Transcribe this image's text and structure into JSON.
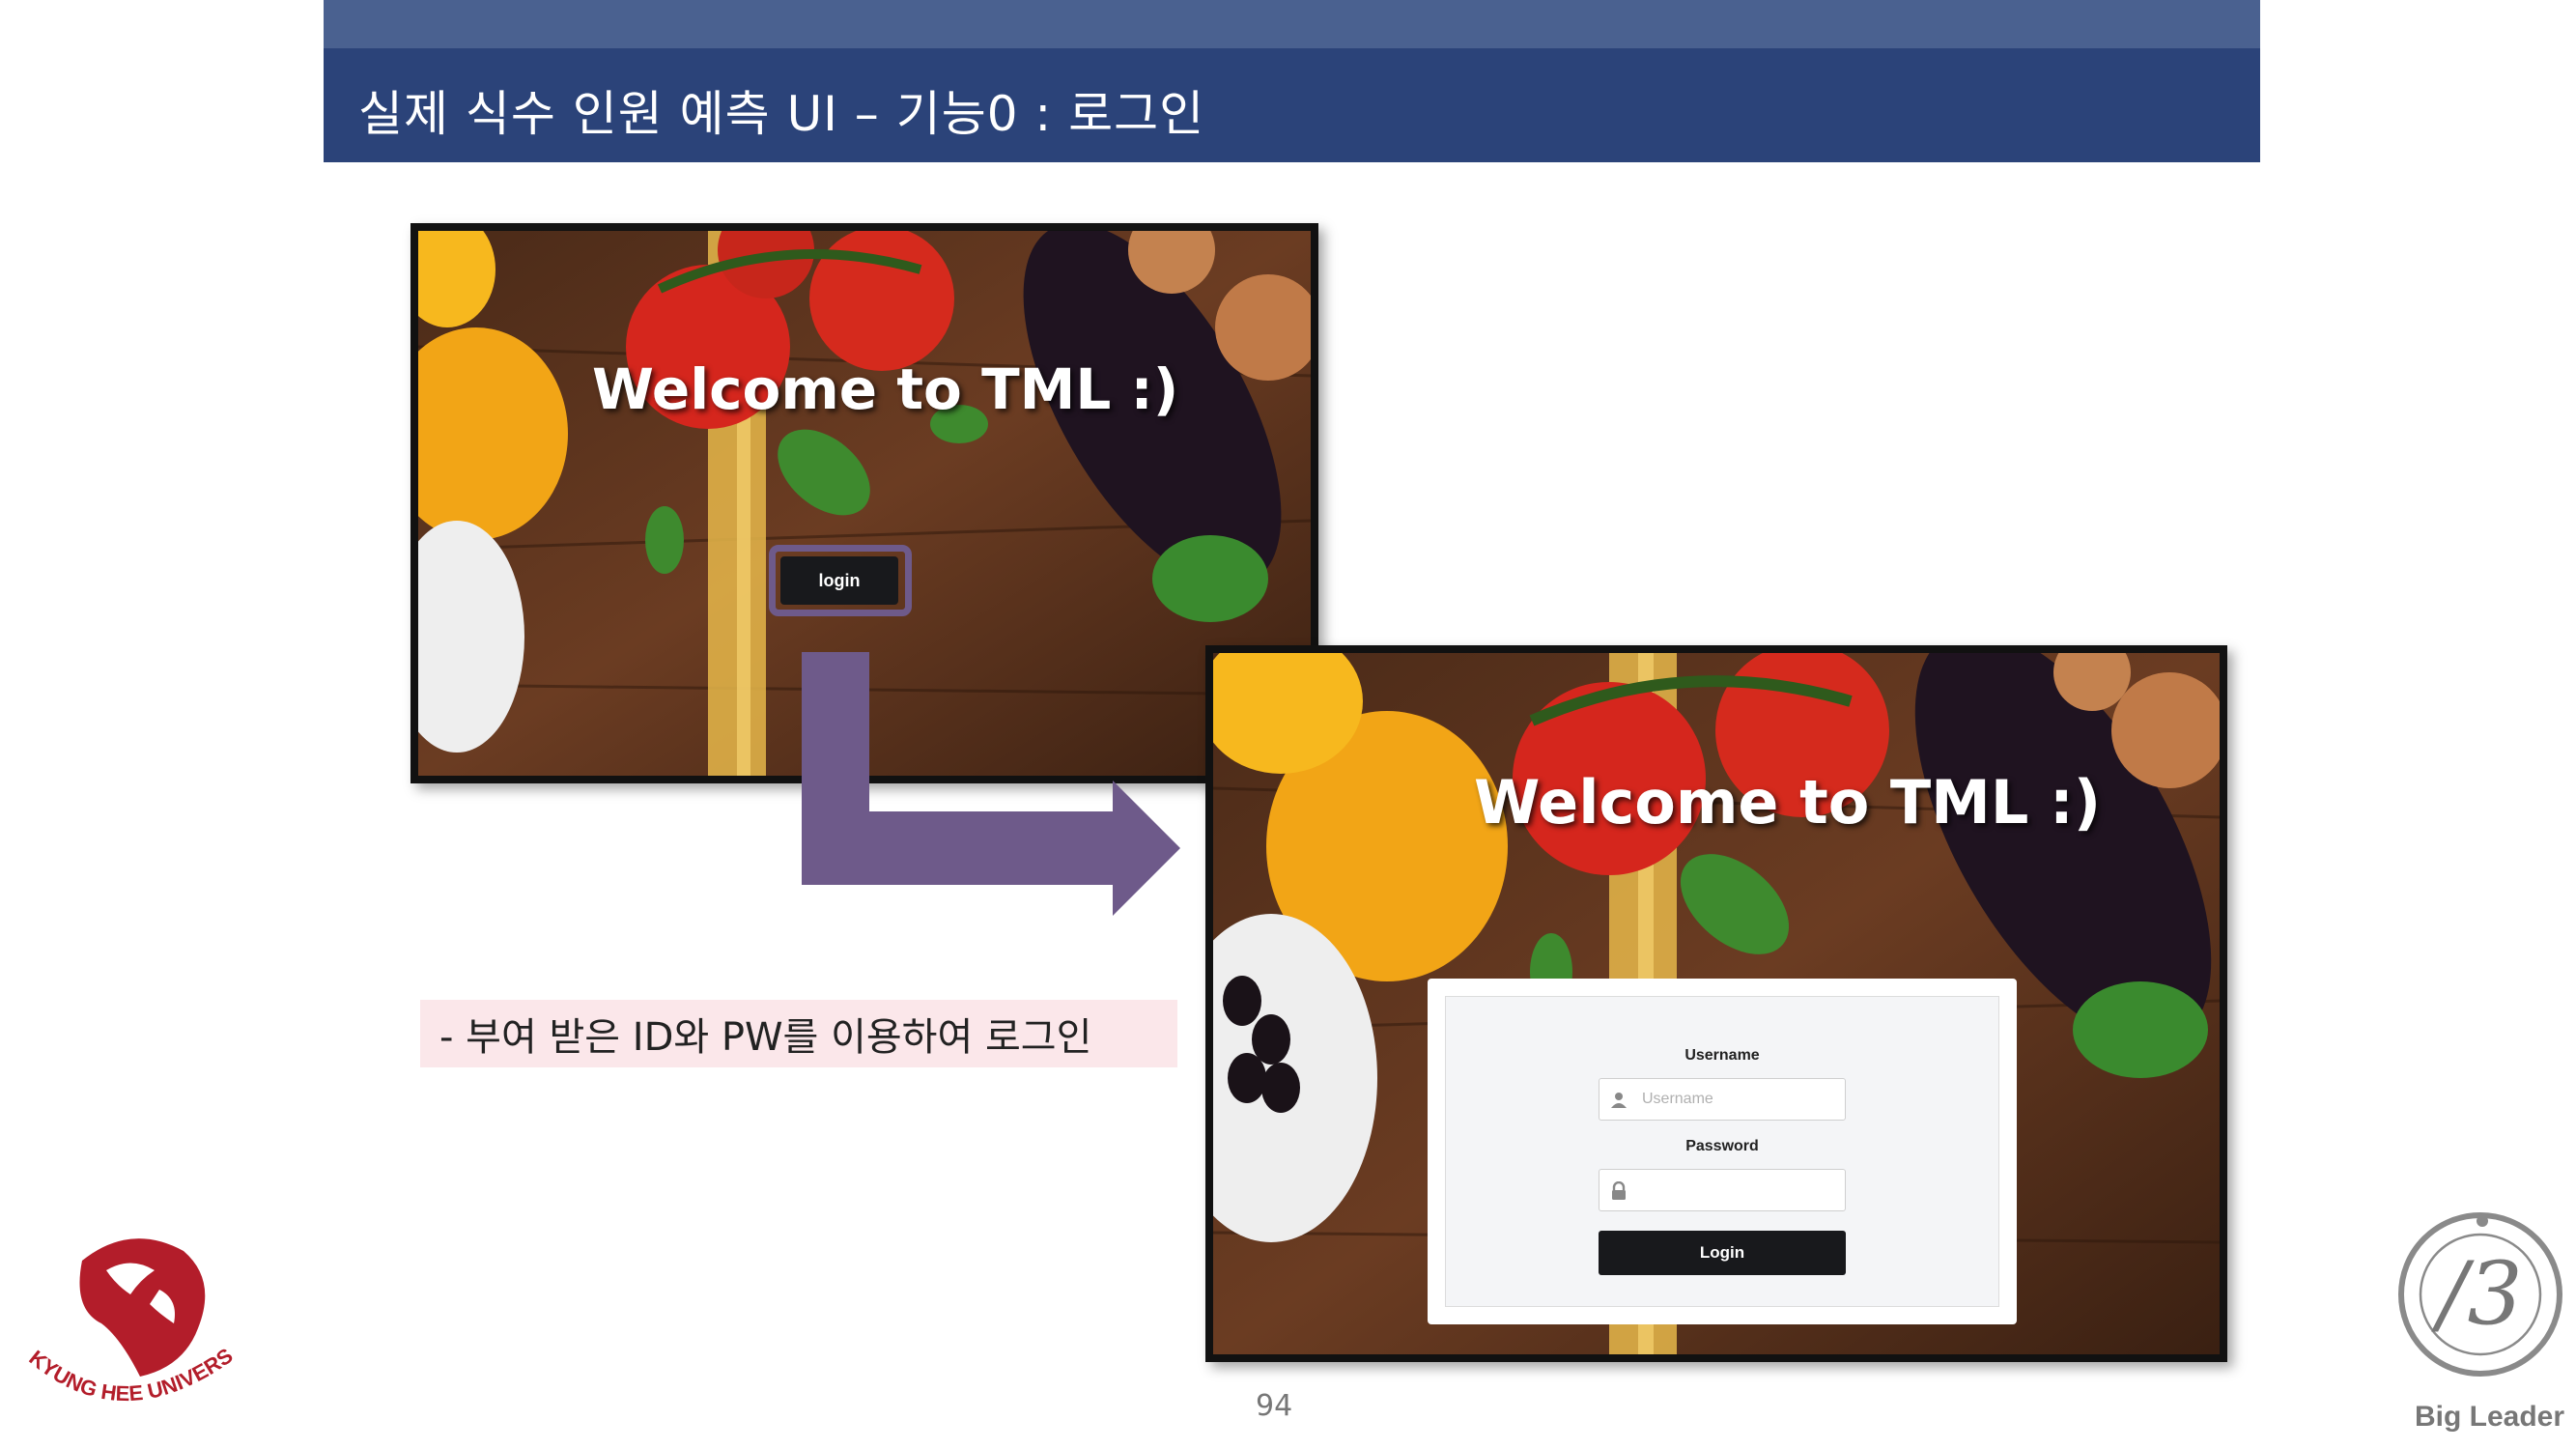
{
  "slide": {
    "title": "실제 식수 인원 예측 UI – 기능0 : 로그인",
    "page_number": "94",
    "caption": "- 부여 받은 ID와 PW를 이용하여 로그인"
  },
  "screen1": {
    "welcome": "Welcome to TML :)",
    "login_button": "login"
  },
  "screen2": {
    "welcome": "Welcome to TML :)",
    "username_label": "Username",
    "username_placeholder": "Username",
    "password_label": "Password",
    "login_button": "Login"
  },
  "logos": {
    "left": "KYUNG HEE UNIVERSITY",
    "right": "Big Leader"
  },
  "colors": {
    "title_bar": "#2b4379",
    "top_band": "#4a6190",
    "arrow": "#6e5a8a",
    "caption_bg": "#fbe7ea",
    "button": "#18191c"
  },
  "icons": {
    "username": "user-icon",
    "password": "lock-icon"
  }
}
